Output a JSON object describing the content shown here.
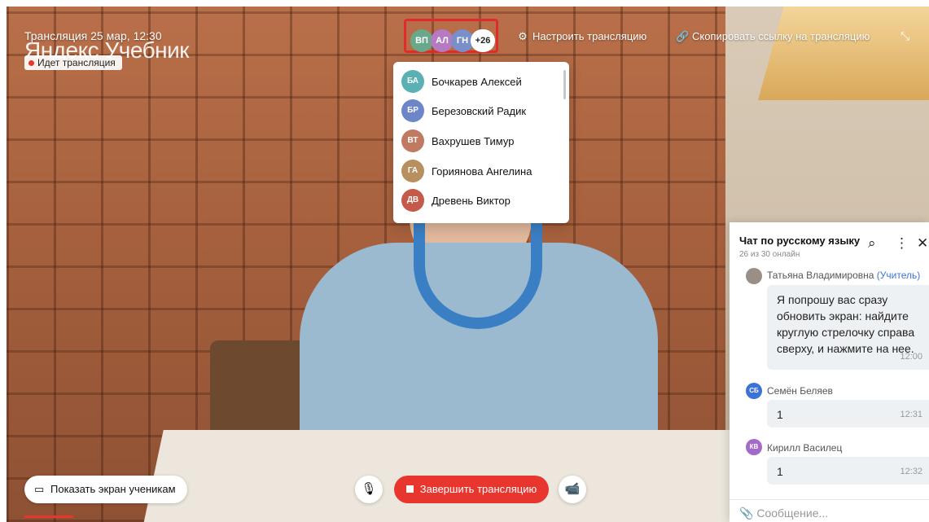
{
  "stream": {
    "title": "Трансляция 25 мар, 12:30",
    "brand": "Яндекс Учебник",
    "live_badge": "Идет трансляция"
  },
  "participants_bar": {
    "avatars": [
      {
        "initials": "ВП",
        "color": "#6aa88a"
      },
      {
        "initials": "АЛ",
        "color": "#b57ac2"
      },
      {
        "initials": "ГН",
        "color": "#7a8fc9"
      }
    ],
    "more_count": "+26"
  },
  "top_actions": {
    "settings_label": "Настроить трансляцию",
    "settings_icon": "gear-icon",
    "copy_link_label": "Скопировать ссылку на трансляцию",
    "copy_link_icon": "link-icon",
    "expand_icon": "collapse-icon"
  },
  "participants_dropdown": [
    {
      "initials": "БА",
      "name": "Бочкарев Алексей",
      "color": "#5bb0b4"
    },
    {
      "initials": "БР",
      "name": "Березовский Радик",
      "color": "#6c86c9"
    },
    {
      "initials": "ВТ",
      "name": "Вахрушев Тимур",
      "color": "#c07a62"
    },
    {
      "initials": "ГА",
      "name": "Горияновa Ангелина",
      "color": "#b89060"
    },
    {
      "initials": "ДВ",
      "name": "Древень Виктор",
      "color": "#c55a4a"
    }
  ],
  "chat": {
    "title": "Чат по русскому языку",
    "subtitle": "26 из 30 онлайн",
    "messages": [
      {
        "author": "Татьяна Владимировна",
        "role": "(Учитель)",
        "text": "Я попрошу вас сразу обновить экран: найдите круглую стрелочку справа сверху, и нажмите на нее.",
        "time": "12:00",
        "avatar_color": "#9a8f86",
        "initials": ""
      },
      {
        "author": "Семён Беляев",
        "role": "",
        "text": "1",
        "time": "12:31",
        "avatar_color": "#3d73d6",
        "initials": "СБ"
      },
      {
        "author": "Кирилл Василец",
        "role": "",
        "text": "1",
        "time": "12:32",
        "avatar_color": "#a36ac9",
        "initials": "КВ"
      }
    ],
    "input_placeholder": "Сообщение..."
  },
  "bottom_controls": {
    "share_screen_label": "Показать экран ученикам",
    "end_stream_label": "Завершить трансляцию",
    "mic_icon": "microphone-icon",
    "camera_icon": "camera-icon"
  },
  "colors": {
    "accent_red": "#e8352e",
    "link_blue": "#3d73d6"
  }
}
